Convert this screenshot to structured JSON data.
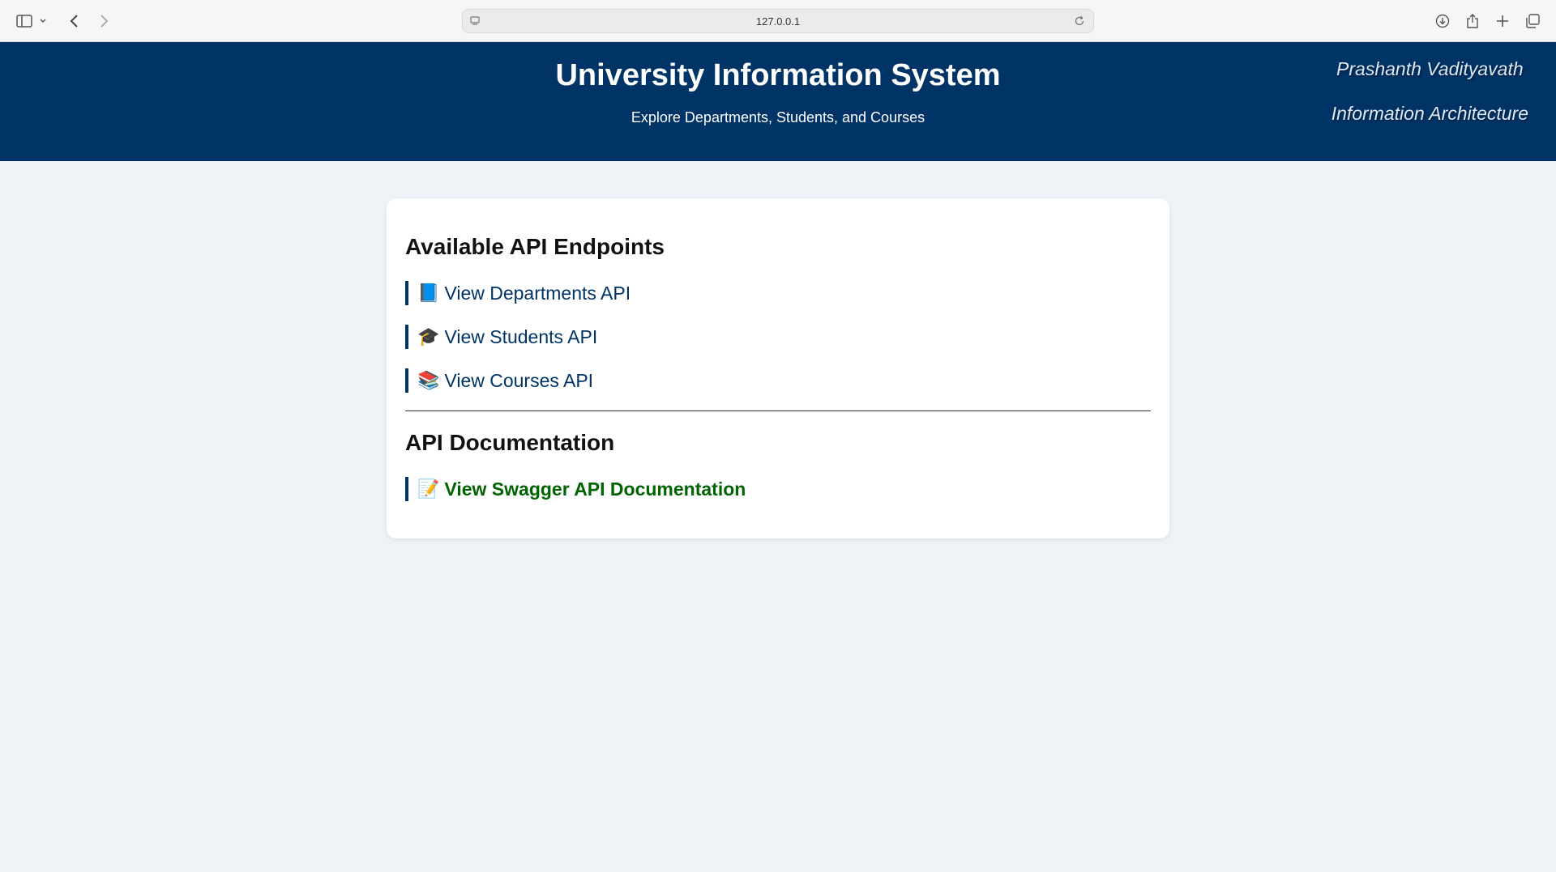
{
  "browser": {
    "url": "127.0.0.1"
  },
  "header": {
    "title": "University Information System",
    "subtitle": "Explore Departments, Students, and Courses",
    "author_name": "Prashanth Vadityavath",
    "author_course": "Information Architecture"
  },
  "endpoints_section": {
    "heading": "Available API Endpoints",
    "items": [
      {
        "icon": "blue-book-icon",
        "emoji": "📘",
        "label": "View Departments API"
      },
      {
        "icon": "graduation-cap-icon",
        "emoji": "🎓",
        "label": "View Students API"
      },
      {
        "icon": "books-icon",
        "emoji": "📚",
        "label": "View Courses API"
      }
    ]
  },
  "docs_section": {
    "heading": "API Documentation",
    "link": {
      "icon": "memo-icon",
      "emoji": "📝",
      "label": "View Swagger API Documentation"
    }
  },
  "colors": {
    "header_bg": "#003366",
    "page_bg": "#eef3f8",
    "link": "#003366",
    "docs_link": "#006400"
  }
}
